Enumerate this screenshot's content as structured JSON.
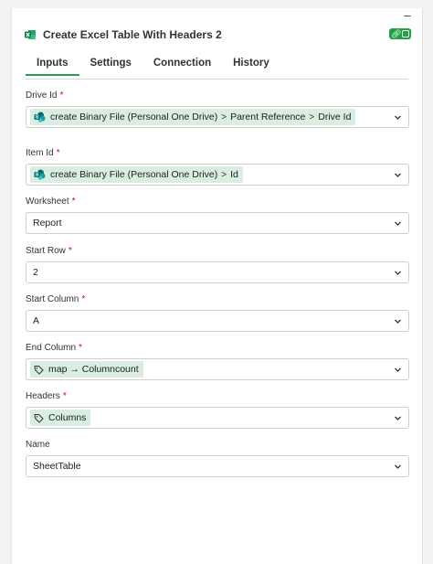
{
  "panel": {
    "title": "Create Excel Table With Headers 2",
    "minimize_glyph": "–",
    "status_toggle": "enabled",
    "accent_color": "#21a146"
  },
  "tabs": [
    {
      "label": "Inputs",
      "active": true
    },
    {
      "label": "Settings",
      "active": false
    },
    {
      "label": "Connection",
      "active": false
    },
    {
      "label": "History",
      "active": false
    }
  ],
  "fields": {
    "drive_id": {
      "label": "Drive Id",
      "required_mark": "*",
      "chip_icon": "sharepoint-icon",
      "path": [
        "create Binary File (Personal One Drive)",
        "Parent Reference",
        "Drive Id"
      ]
    },
    "item_id": {
      "label": "Item Id",
      "required_mark": "*",
      "chip_icon": "sharepoint-icon",
      "path": [
        "create Binary File (Personal One Drive)",
        "Id"
      ]
    },
    "worksheet": {
      "label": "Worksheet",
      "required_mark": "*",
      "value": "Report"
    },
    "start_row": {
      "label": "Start Row",
      "required_mark": "*",
      "value": "2"
    },
    "start_column": {
      "label": "Start Column",
      "required_mark": "*",
      "value": "A"
    },
    "end_column": {
      "label": "End Column",
      "required_mark": "*",
      "chip_icon": "tag-icon",
      "value": "map → Columncount"
    },
    "headers": {
      "label": "Headers",
      "required_mark": "*",
      "chip_icon": "tag-icon",
      "value": "Columns"
    },
    "name": {
      "label": "Name",
      "value": "SheetTable"
    }
  },
  "separator_glyph": ">"
}
